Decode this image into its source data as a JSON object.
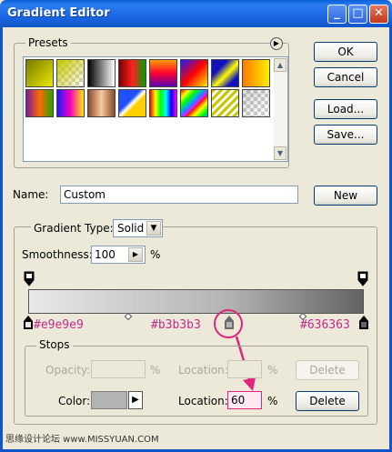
{
  "window": {
    "title": "Gradient Editor"
  },
  "titlebar_buttons": {
    "minimize": "_",
    "maximize": "□",
    "close": "✕"
  },
  "presets": {
    "label": "Presets",
    "menu_icon": "triangle-right-icon",
    "swatches": [
      {
        "style": "linear-gradient(135deg, #7a7a00, #e8e800)"
      },
      {
        "style": "linear-gradient(135deg, #c8c800 0%, rgba(255,255,255,0) 100%)",
        "checker": true
      },
      {
        "style": "linear-gradient(to right, #000000, #ffffff)"
      },
      {
        "style": "linear-gradient(to right, #7a0000, #ff2020, #00a000)"
      },
      {
        "style": "linear-gradient(to bottom, #ff9b00, #ff0030, #5a00b0)"
      },
      {
        "style": "linear-gradient(135deg, #1a1aff, #ff0000, #ffee00)"
      },
      {
        "style": "linear-gradient(135deg, #1010c0 30%, #ffff00 55%, #1010c0 80%)"
      },
      {
        "style": "linear-gradient(to right, #ff7a00, #ffee00)"
      },
      {
        "style": "linear-gradient(to right, #7a1a9a, #ff6a00, #2aa000)"
      },
      {
        "style": "linear-gradient(to right, #1a1aff, #ff00c0, #ffee00)"
      },
      {
        "style": "linear-gradient(to right, #8a4a2a, #f6caa0, #8a4a2a)"
      },
      {
        "style": "linear-gradient(135deg, #2050ff 40%, #ffffff 50%, #ffd000 60%)"
      },
      {
        "style": "linear-gradient(to right, #ff0000, #ffff00, #00ff00, #00ffff, #0000ff, #ff00ff)"
      },
      {
        "style": "repeating-linear-gradient(135deg, #ff0000 0px, #ffff00 6px, #00ff00 12px, #00a0ff 18px, #ff00ff 24px)"
      },
      {
        "style": "repeating-linear-gradient(135deg, #c8c800 0px, #c8c800 3px, #ffffff 3px, #ffffff 6px)"
      },
      {
        "style": "linear-gradient(135deg, rgba(0,0,0,0.15), rgba(0,0,0,0))",
        "checker": true
      }
    ]
  },
  "buttons": {
    "ok": "OK",
    "cancel": "Cancel",
    "load": "Load...",
    "save": "Save...",
    "new": "New",
    "delete_opacity": "Delete",
    "delete_color": "Delete"
  },
  "name_field": {
    "label": "Name:",
    "value": "Custom"
  },
  "gradient_type": {
    "label": "Gradient Type:",
    "selected": "Solid",
    "smoothness_label": "Smoothness:",
    "smoothness_value": "100",
    "percent": "%"
  },
  "gradient": {
    "stops": [
      {
        "location_percent": 0,
        "color": "#e9e9e9"
      },
      {
        "location_percent": 60,
        "color": "#b3b3b3"
      },
      {
        "location_percent": 100,
        "color": "#636363"
      }
    ],
    "hex_labels": [
      "#e9e9e9",
      "#b3b3b3",
      "#636363"
    ],
    "annotation_color": "#e3247f"
  },
  "stops_group": {
    "label": "Stops",
    "opacity_label": "Opacity:",
    "opacity_percent": "%",
    "opacity_location_label": "Location:",
    "opacity_location_percent": "%",
    "color_label": "Color:",
    "color_value": "#b3b3b3",
    "color_location_label": "Location:",
    "color_location_value": "60",
    "color_location_percent": "%"
  },
  "watermark": "思缘设计论坛  www.MISSYUAN.COM"
}
